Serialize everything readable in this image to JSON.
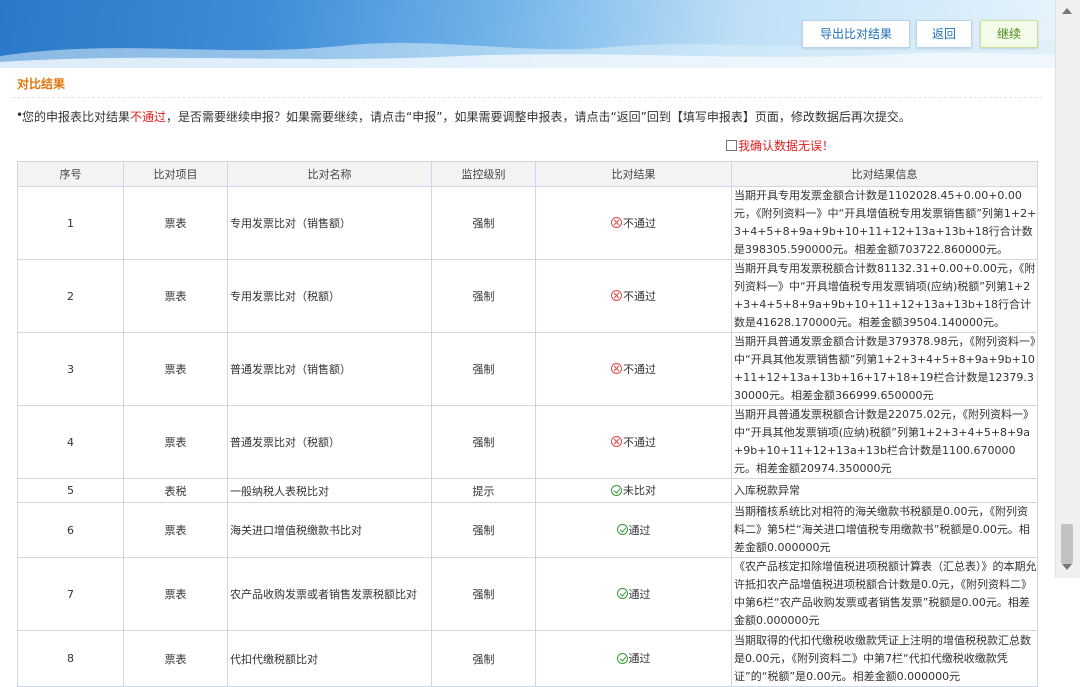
{
  "header": {
    "export_label": "导出比对结果",
    "back_label": "返回",
    "continue_label": "继续"
  },
  "section_title": "对比结果",
  "notice": {
    "prefix": "您的申报表比对结果",
    "fail_word": "不通过",
    "suffix": "，是否需要继续申报？如果需要继续，请点击“申报”，如果需要调整申报表，请点击“返回”回到【填写申报表】页面，修改数据后再次提交。"
  },
  "confirm_label": "我确认数据无误！",
  "table": {
    "headers": [
      "序号",
      "比对项目",
      "比对名称",
      "监控级别",
      "比对结果",
      "比对结果信息"
    ],
    "rows": [
      {
        "no": "1",
        "item": "票表",
        "name": "专用发票比对（销售额）",
        "level": "强制",
        "result": "不通过",
        "status": "fail",
        "info": "当期开具专用发票金额合计数是1102028.45+0.00+0.00元，《附列资料一》中“开具增值税专用发票销售额”列第1+2+3+4+5+8+9a+9b+10+11+12+13a+13b+18行合计数是398305.590000元。相差金额703722.860000元。"
      },
      {
        "no": "2",
        "item": "票表",
        "name": "专用发票比对（税额）",
        "level": "强制",
        "result": "不通过",
        "status": "fail",
        "info": "当期开具专用发票税额合计数81132.31+0.00+0.00元，《附列资料一》中“开具增值税专用发票销项(应纳)税额”列第1+2+3+4+5+8+9a+9b+10+11+12+13a+13b+18行合计数是41628.170000元。相差金额39504.140000元。"
      },
      {
        "no": "3",
        "item": "票表",
        "name": "普通发票比对（销售额）",
        "level": "强制",
        "result": "不通过",
        "status": "fail",
        "info": "当期开具普通发票金额合计数是379378.98元，《附列资料一》中“开具其他发票销售额”列第1+2+3+4+5+8+9a+9b+10+11+12+13a+13b+16+17+18+19栏合计数是12379.330000元。相差金额366999.650000元"
      },
      {
        "no": "4",
        "item": "票表",
        "name": "普通发票比对（税额）",
        "level": "强制",
        "result": "不通过",
        "status": "fail",
        "info": "当期开具普通发票税额合计数是22075.02元，《附列资料一》中“开具其他发票销项(应纳)税额”列第1+2+3+4+5+8+9a+9b+10+11+12+13a+13b栏合计数是1100.670000元。相差金额20974.350000元"
      },
      {
        "no": "5",
        "item": "表税",
        "name": "一般纳税人表税比对",
        "level": "提示",
        "result": "未比对",
        "status": "pass",
        "info": "入库税款异常"
      },
      {
        "no": "6",
        "item": "票表",
        "name": "海关进口增值税缴款书比对",
        "level": "强制",
        "result": "通过",
        "status": "pass",
        "info": "当期稽核系统比对相符的海关缴款书税额是0.00元，《附列资料二》第5栏“海关进口增值税专用缴款书”税额是0.00元。相差金额0.000000元"
      },
      {
        "no": "7",
        "item": "票表",
        "name": "农产品收购发票或者销售发票税额比对",
        "level": "强制",
        "result": "通过",
        "status": "pass",
        "info": "《农产品核定扣除增值税进项税额计算表（汇总表）》的本期允许抵扣农产品增值税进项税额合计数是0.0元，《附列资料二》中第6栏“农产品收购发票或者销售发票”税额是0.00元。相差金额0.000000元"
      },
      {
        "no": "8",
        "item": "票表",
        "name": "代扣代缴税额比对",
        "level": "强制",
        "result": "通过",
        "status": "pass",
        "info": "当期取得的代扣代缴税收缴款凭证上注明的增值税税款汇总数是0.00元，《附列资料二》中第7栏“代扣代缴税收缴款凭证”的“税额”是0.00元。相差金额0.000000元"
      }
    ]
  }
}
